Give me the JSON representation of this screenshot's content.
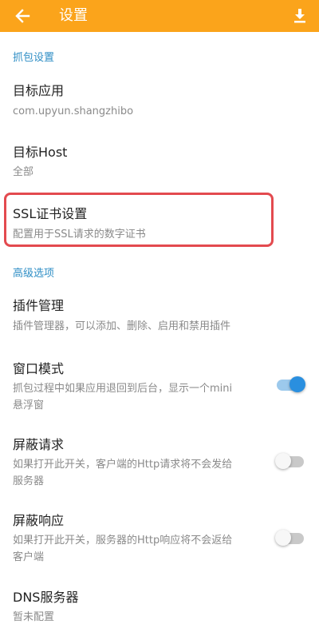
{
  "header": {
    "title": "设置",
    "back_icon": "arrow-left-icon",
    "download_icon": "download-icon"
  },
  "sections": {
    "capture": {
      "label": "抓包设置",
      "target_app": {
        "title": "目标应用",
        "summary": "com.upyun.shangzhibo"
      },
      "target_host": {
        "title": "目标Host",
        "summary": "全部"
      },
      "ssl_cert": {
        "title": "SSL证书设置",
        "summary": "配置用于SSL请求的数字证书"
      }
    },
    "advanced": {
      "label": "高级选项",
      "plugin_mgmt": {
        "title": "插件管理",
        "summary": "插件管理器，可以添加、删除、启用和禁用插件"
      },
      "window_mode": {
        "title": "窗口模式",
        "summary": "抓包过程中如果应用退回到后台，显示一个mini\n悬浮窗",
        "enabled": true
      },
      "block_request": {
        "title": "屏蔽请求",
        "summary": "如果打开此开关，客户端的Http请求将不会发给\n服务器",
        "enabled": false
      },
      "block_response": {
        "title": "屏蔽响应",
        "summary": "如果打开此开关，服务器的Http响应将不会返给\n客户端",
        "enabled": false
      },
      "dns_server": {
        "title": "DNS服务器",
        "summary": "暂未配置"
      }
    }
  },
  "colors": {
    "appbar": "#fba41b",
    "section": "#2e8ec5",
    "highlight": "#e34a4f",
    "toggle_on": "#2a8fdf"
  }
}
